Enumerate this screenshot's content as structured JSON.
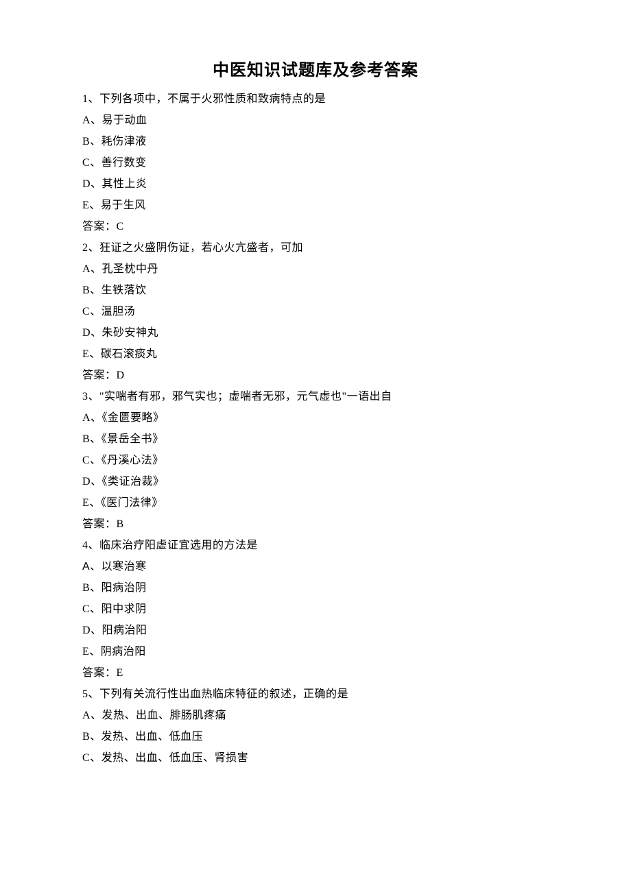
{
  "title": "中医知识试题库及参考答案",
  "questions": [
    {
      "stem": "1、下列各项中，不属于火邪性质和致病特点的是",
      "options": [
        "A、易于动血",
        "B、耗伤津液",
        "C、善行数变",
        "D、其性上炎",
        "E、易于生风"
      ],
      "answer": "答案：C"
    },
    {
      "stem": "2、狂证之火盛阴伤证，若心火亢盛者，可加",
      "options": [
        "A、孔圣枕中丹",
        "B、生铁落饮",
        "C、温胆汤",
        "D、朱砂安神丸",
        "E、碳石滚痰丸"
      ],
      "answer": "答案：D"
    },
    {
      "stem": "3、\"实喘者有邪，邪气实也；虚喘者无邪，元气虚也\"一语出自",
      "options": [
        "A、《金匮要略》",
        "B、《景岳全书》",
        "C、《丹溪心法》",
        "D、《类证治裁》",
        "E、《医门法律》"
      ],
      "answer": "答案：B"
    },
    {
      "stem": "4、临床治疗阳虚证宜选用的方法是",
      "options": [
        "A、以寒治寒",
        "B、阳病治阴",
        "C、阳中求阴",
        "D、阳病治阳",
        "E、阴病治阳"
      ],
      "answer": "答案：E",
      "altFirst": true
    },
    {
      "stem": "5、下列有关流行性出血热临床特征的叙述，正确的是",
      "options": [
        "A、发热、出血、腓肠肌疼痛",
        "B、发热、出血、低血压",
        "C、发热、出血、低血压、肾损害"
      ]
    }
  ]
}
